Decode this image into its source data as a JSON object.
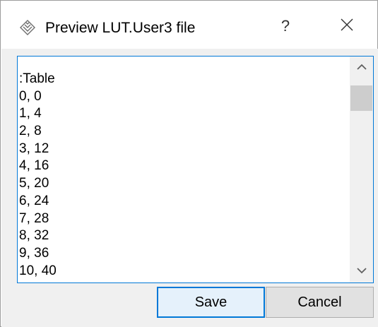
{
  "window": {
    "title": "Preview LUT.User3 file",
    "help_label": "?"
  },
  "icons": {
    "app": "app-logo-icon",
    "close": "close-icon",
    "scroll_up": "chevron-up-icon",
    "scroll_down": "chevron-down-icon"
  },
  "preview": {
    "lines": [
      ":Table",
      "0, 0",
      "1, 4",
      "2, 8",
      "3, 12",
      "4, 16",
      "5, 20",
      "6, 24",
      "7, 28",
      "8, 32",
      "9, 36",
      "10, 40"
    ]
  },
  "buttons": {
    "save_label": "Save",
    "cancel_label": "Cancel"
  },
  "colors": {
    "focus_border": "#0078d7",
    "dialog_background": "#f0f0f0",
    "button_face": "#e1e1e1",
    "scroll_thumb": "#cdcdcd"
  }
}
